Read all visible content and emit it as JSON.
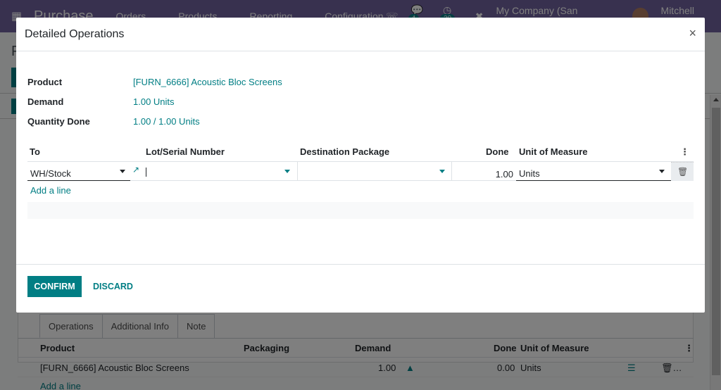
{
  "app": {
    "brand": "Purchase",
    "menu": [
      "Orders",
      "Products",
      "Reporting",
      "Configuration"
    ],
    "messages_count": "4",
    "activities_count": "30",
    "company": "My Company (San Francisco)",
    "user": "Mitchell Admin",
    "record_title": "P",
    "colors": {
      "brand": "#71639e",
      "accent": "#017e84"
    }
  },
  "background": {
    "tabs": [
      {
        "label": "Operations",
        "active": true
      },
      {
        "label": "Additional Info",
        "active": false
      },
      {
        "label": "Note",
        "active": false
      }
    ],
    "columns": [
      "Product",
      "Packaging",
      "Demand",
      "Done",
      "Unit of Measure"
    ],
    "rows": [
      {
        "product": "[FURN_6666] Acoustic Bloc Screens",
        "packaging": "",
        "demand": "1.00",
        "done": "0.00",
        "uom": "Units"
      }
    ],
    "add_line": "Add a line"
  },
  "dialog": {
    "title": "Detailed Operations",
    "close_label": "×",
    "fields": {
      "product_label": "Product",
      "product_value": "[FURN_6666] Acoustic Bloc Screens",
      "demand_label": "Demand",
      "demand_value": "1.00 Units",
      "qty_done_label": "Quantity Done",
      "qty_done_value": "1.00 / 1.00 Units"
    },
    "columns": {
      "to": "To",
      "lot": "Lot/Serial Number",
      "dest_package": "Destination Package",
      "done": "Done",
      "uom": "Unit of Measure"
    },
    "line": {
      "to": "WH/Stock",
      "lot": "",
      "dest_package": "",
      "done": "1.00",
      "uom": "Units"
    },
    "add_line": "Add a line",
    "confirm": "CONFIRM",
    "discard": "DISCARD"
  }
}
